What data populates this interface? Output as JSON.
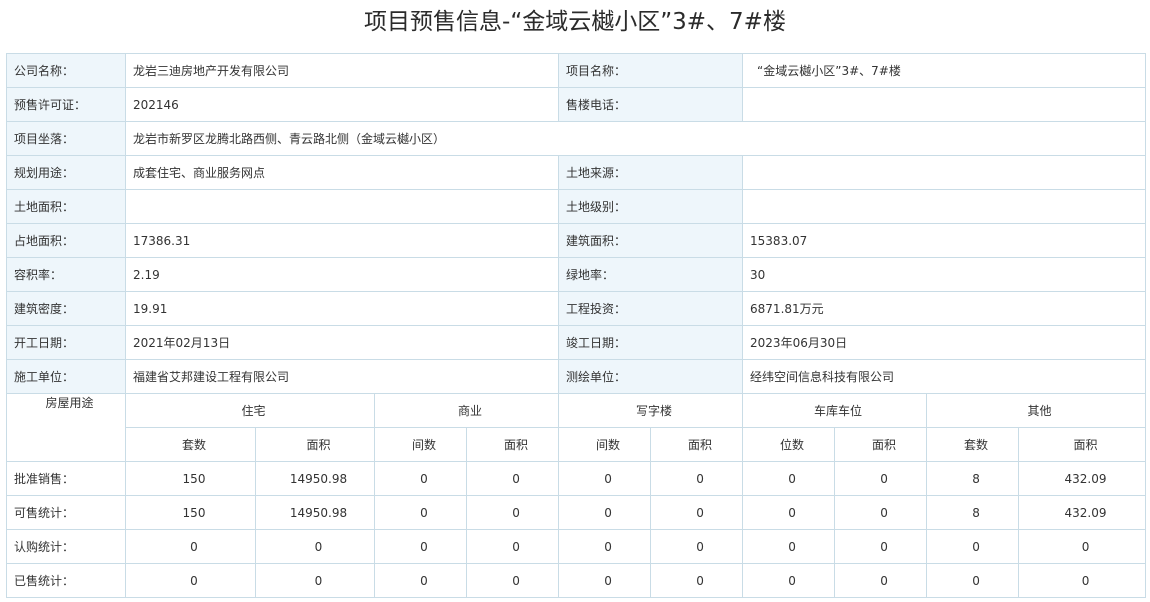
{
  "title": "项目预售信息-“金域云樾小区”3#、7#楼",
  "info": {
    "company_label": "公司名称：",
    "company": "龙岩三迪房地产开发有限公司",
    "project_label": "项目名称：",
    "project": "“金域云樾小区”3#、7#楼",
    "permit_label": "预售许可证：",
    "permit": "202146",
    "phone_label": "售楼电话：",
    "phone": "",
    "location_label": "项目坐落：",
    "location": "龙岩市新罗区龙腾北路西侧、青云路北侧（金域云樾小区）",
    "usage_label": "规划用途：",
    "usage": "成套住宅、商业服务网点",
    "land_source_label": "土地来源：",
    "land_source": "",
    "land_area_label": "土地面积：",
    "land_area": "",
    "land_grade_label": "土地级别：",
    "land_grade": "",
    "site_area_label": "占地面积：",
    "site_area": "17386.31",
    "build_area_label": "建筑面积：",
    "build_area": "15383.07",
    "plot_ratio_label": "容积率：",
    "plot_ratio": "2.19",
    "green_ratio_label": "绿地率：",
    "green_ratio": "30",
    "density_label": "建筑密度：",
    "density": "19.91",
    "investment_label": "工程投资：",
    "investment": "6871.81万元",
    "start_label": "开工日期：",
    "start": "2021年02月13日",
    "finish_label": "竣工日期：",
    "finish": "2023年06月30日",
    "builder_label": "施工单位：",
    "builder": "福建省艾邦建设工程有限公司",
    "surveyor_label": "测绘单位：",
    "surveyor": "经纬空间信息科技有限公司"
  },
  "stats": {
    "usage_header": "房屋用途",
    "groups": [
      "住宅",
      "商业",
      "写字楼",
      "车库车位",
      "其他"
    ],
    "subheaders": [
      "套数",
      "面积",
      "间数",
      "面积",
      "间数",
      "面积",
      "位数",
      "面积",
      "套数",
      "面积"
    ],
    "rows": [
      {
        "label": "批准销售：",
        "values": [
          "150",
          "14950.98",
          "0",
          "0",
          "0",
          "0",
          "0",
          "0",
          "8",
          "432.09"
        ]
      },
      {
        "label": "可售统计：",
        "values": [
          "150",
          "14950.98",
          "0",
          "0",
          "0",
          "0",
          "0",
          "0",
          "8",
          "432.09"
        ]
      },
      {
        "label": "认购统计：",
        "values": [
          "0",
          "0",
          "0",
          "0",
          "0",
          "0",
          "0",
          "0",
          "0",
          "0"
        ]
      },
      {
        "label": "已售统计：",
        "values": [
          "0",
          "0",
          "0",
          "0",
          "0",
          "0",
          "0",
          "0",
          "0",
          "0"
        ]
      }
    ]
  }
}
